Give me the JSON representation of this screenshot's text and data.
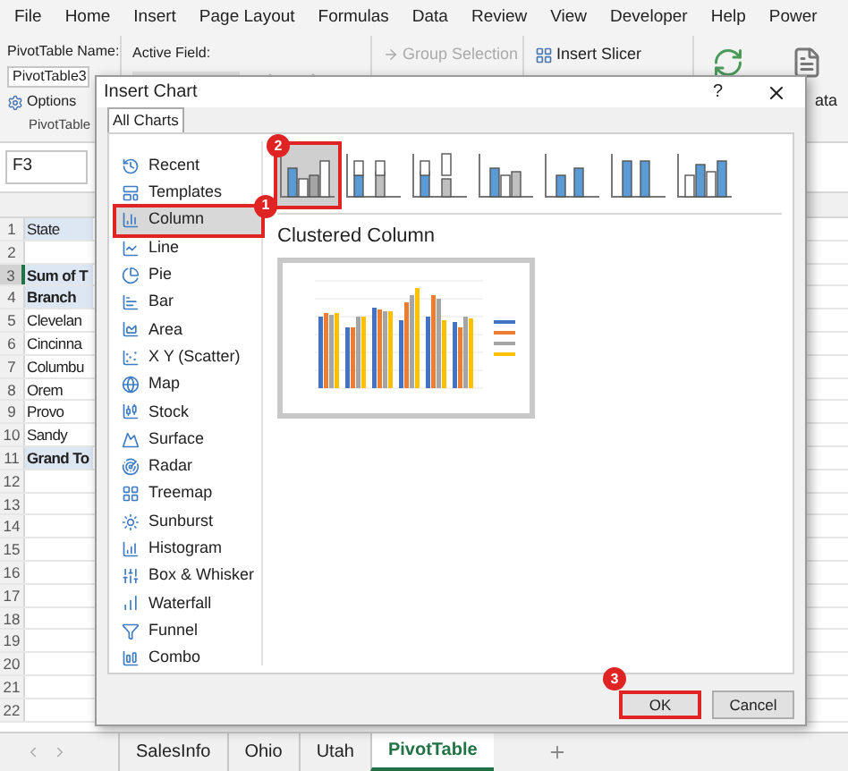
{
  "ribbon_tabs": [
    {
      "label": "File",
      "selected": false
    },
    {
      "label": "Home",
      "selected": false
    },
    {
      "label": "Insert",
      "selected": false
    },
    {
      "label": "Page Layout",
      "selected": false
    },
    {
      "label": "Formulas",
      "selected": false
    },
    {
      "label": "Data",
      "selected": false
    },
    {
      "label": "Review",
      "selected": false
    },
    {
      "label": "View",
      "selected": false
    },
    {
      "label": "Developer",
      "selected": false
    },
    {
      "label": "Help",
      "selected": false
    },
    {
      "label": "Power",
      "selected": false
    }
  ],
  "ribbon": {
    "pivot_name_label": "PivotTable Name:",
    "pivot_name_value": "PivotTable3",
    "options": "Options",
    "group_label": "PivotTable",
    "active_field_label": "Active Field:",
    "group_selection": "Group Selection",
    "insert_slicer": "Insert Slicer",
    "partial_label": "ata"
  },
  "name_box": "F3",
  "rows": [
    {
      "number": "1",
      "cell": "State",
      "kind": "field",
      "selected": false
    },
    {
      "number": "2",
      "kind": "empty",
      "selected": false
    },
    {
      "number": "3",
      "cell": "Sum of T",
      "kind": "heading",
      "selected": true
    },
    {
      "number": "4",
      "cell": "Branch",
      "kind": "heading",
      "selected": false
    },
    {
      "number": "5",
      "cell": "Clevelan",
      "kind": "item",
      "selected": false
    },
    {
      "number": "6",
      "cell": "Cincinna",
      "kind": "item",
      "selected": false
    },
    {
      "number": "7",
      "cell": "Columbu",
      "kind": "item",
      "selected": false
    },
    {
      "number": "8",
      "cell": "Orem",
      "kind": "item",
      "selected": false
    },
    {
      "number": "9",
      "cell": "Provo",
      "kind": "item",
      "selected": false
    },
    {
      "number": "10",
      "cell": "Sandy",
      "kind": "item",
      "selected": false
    },
    {
      "number": "11",
      "cell": "Grand To",
      "kind": "heading",
      "selected": false
    },
    {
      "number": "12",
      "kind": "empty",
      "selected": false
    },
    {
      "number": "13",
      "kind": "empty",
      "selected": false
    },
    {
      "number": "14",
      "kind": "empty",
      "selected": false
    },
    {
      "number": "15",
      "kind": "empty",
      "selected": false
    },
    {
      "number": "16",
      "kind": "empty",
      "selected": false
    },
    {
      "number": "17",
      "kind": "empty",
      "selected": false
    },
    {
      "number": "18",
      "kind": "empty",
      "selected": false
    },
    {
      "number": "19",
      "kind": "empty",
      "selected": false
    },
    {
      "number": "20",
      "kind": "empty",
      "selected": false
    },
    {
      "number": "21",
      "kind": "empty",
      "selected": false
    },
    {
      "number": "22",
      "kind": "empty",
      "selected": false
    }
  ],
  "dialog": {
    "title": "Insert Chart",
    "help": "?",
    "tabs": [
      {
        "label": "All Charts",
        "selected": true
      }
    ],
    "chart_types": [
      {
        "label": "Recent",
        "selected": false
      },
      {
        "label": "Templates",
        "selected": false
      },
      {
        "label": "Column",
        "selected": true,
        "badge": "1"
      },
      {
        "label": "Line",
        "selected": false
      },
      {
        "label": "Pie",
        "selected": false
      },
      {
        "label": "Bar",
        "selected": false
      },
      {
        "label": "Area",
        "selected": false
      },
      {
        "label": "X Y (Scatter)",
        "selected": false
      },
      {
        "label": "Map",
        "selected": false
      },
      {
        "label": "Stock",
        "selected": false
      },
      {
        "label": "Surface",
        "selected": false
      },
      {
        "label": "Radar",
        "selected": false
      },
      {
        "label": "Treemap",
        "selected": false
      },
      {
        "label": "Sunburst",
        "selected": false
      },
      {
        "label": "Histogram",
        "selected": false
      },
      {
        "label": "Box & Whisker",
        "selected": false
      },
      {
        "label": "Waterfall",
        "selected": false
      },
      {
        "label": "Funnel",
        "selected": false
      },
      {
        "label": "Combo",
        "selected": false
      }
    ],
    "subtypes": [
      {
        "kind": "clustered",
        "selected": true,
        "badge": "2"
      },
      {
        "kind": "stacked",
        "selected": false
      },
      {
        "kind": "stacked100",
        "selected": false
      },
      {
        "kind": "clustered3d",
        "selected": false
      },
      {
        "kind": "stacked3d",
        "selected": false
      },
      {
        "kind": "stacked100_3d",
        "selected": false
      },
      {
        "kind": "column3d",
        "selected": false
      }
    ],
    "subtype_title": "Clustered Column",
    "buttons": [
      {
        "label": "OK",
        "badge": "3"
      },
      {
        "label": "Cancel"
      }
    ]
  },
  "sheet_tabs": [
    {
      "label": "SalesInfo",
      "selected": false
    },
    {
      "label": "Ohio",
      "selected": false
    },
    {
      "label": "Utah",
      "selected": false
    },
    {
      "label": "PivotTable",
      "selected": true
    }
  ]
}
